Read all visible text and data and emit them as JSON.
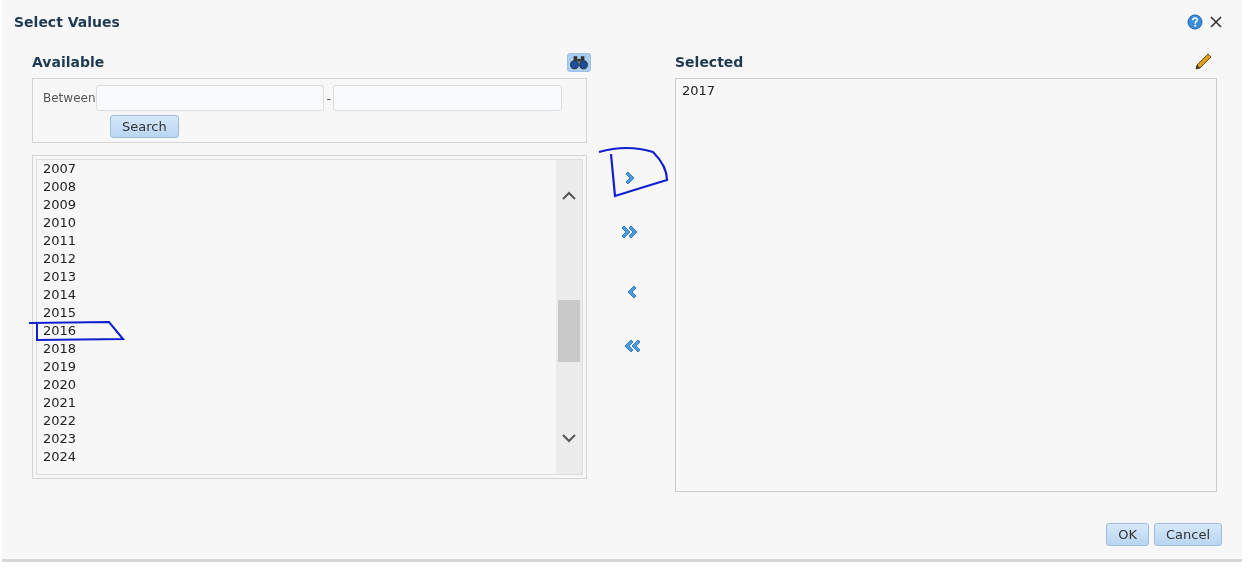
{
  "dialog": {
    "title": "Select Values"
  },
  "available": {
    "heading": "Available",
    "search_label": "Between",
    "range_separator": "-",
    "search_button": "Search",
    "items": [
      "2007",
      "2008",
      "2009",
      "2010",
      "2011",
      "2012",
      "2013",
      "2014",
      "2015",
      "2016",
      "2018",
      "2019",
      "2020",
      "2021",
      "2022",
      "2023",
      "2024"
    ]
  },
  "move_buttons": [
    {
      "kind": "move"
    },
    {
      "kind": "move-all"
    },
    {
      "kind": "remove"
    },
    {
      "kind": "remove-all"
    }
  ],
  "selected": {
    "heading": "Selected",
    "items": [
      "2017"
    ]
  },
  "buttons": [
    "OK",
    "Cancel"
  ]
}
